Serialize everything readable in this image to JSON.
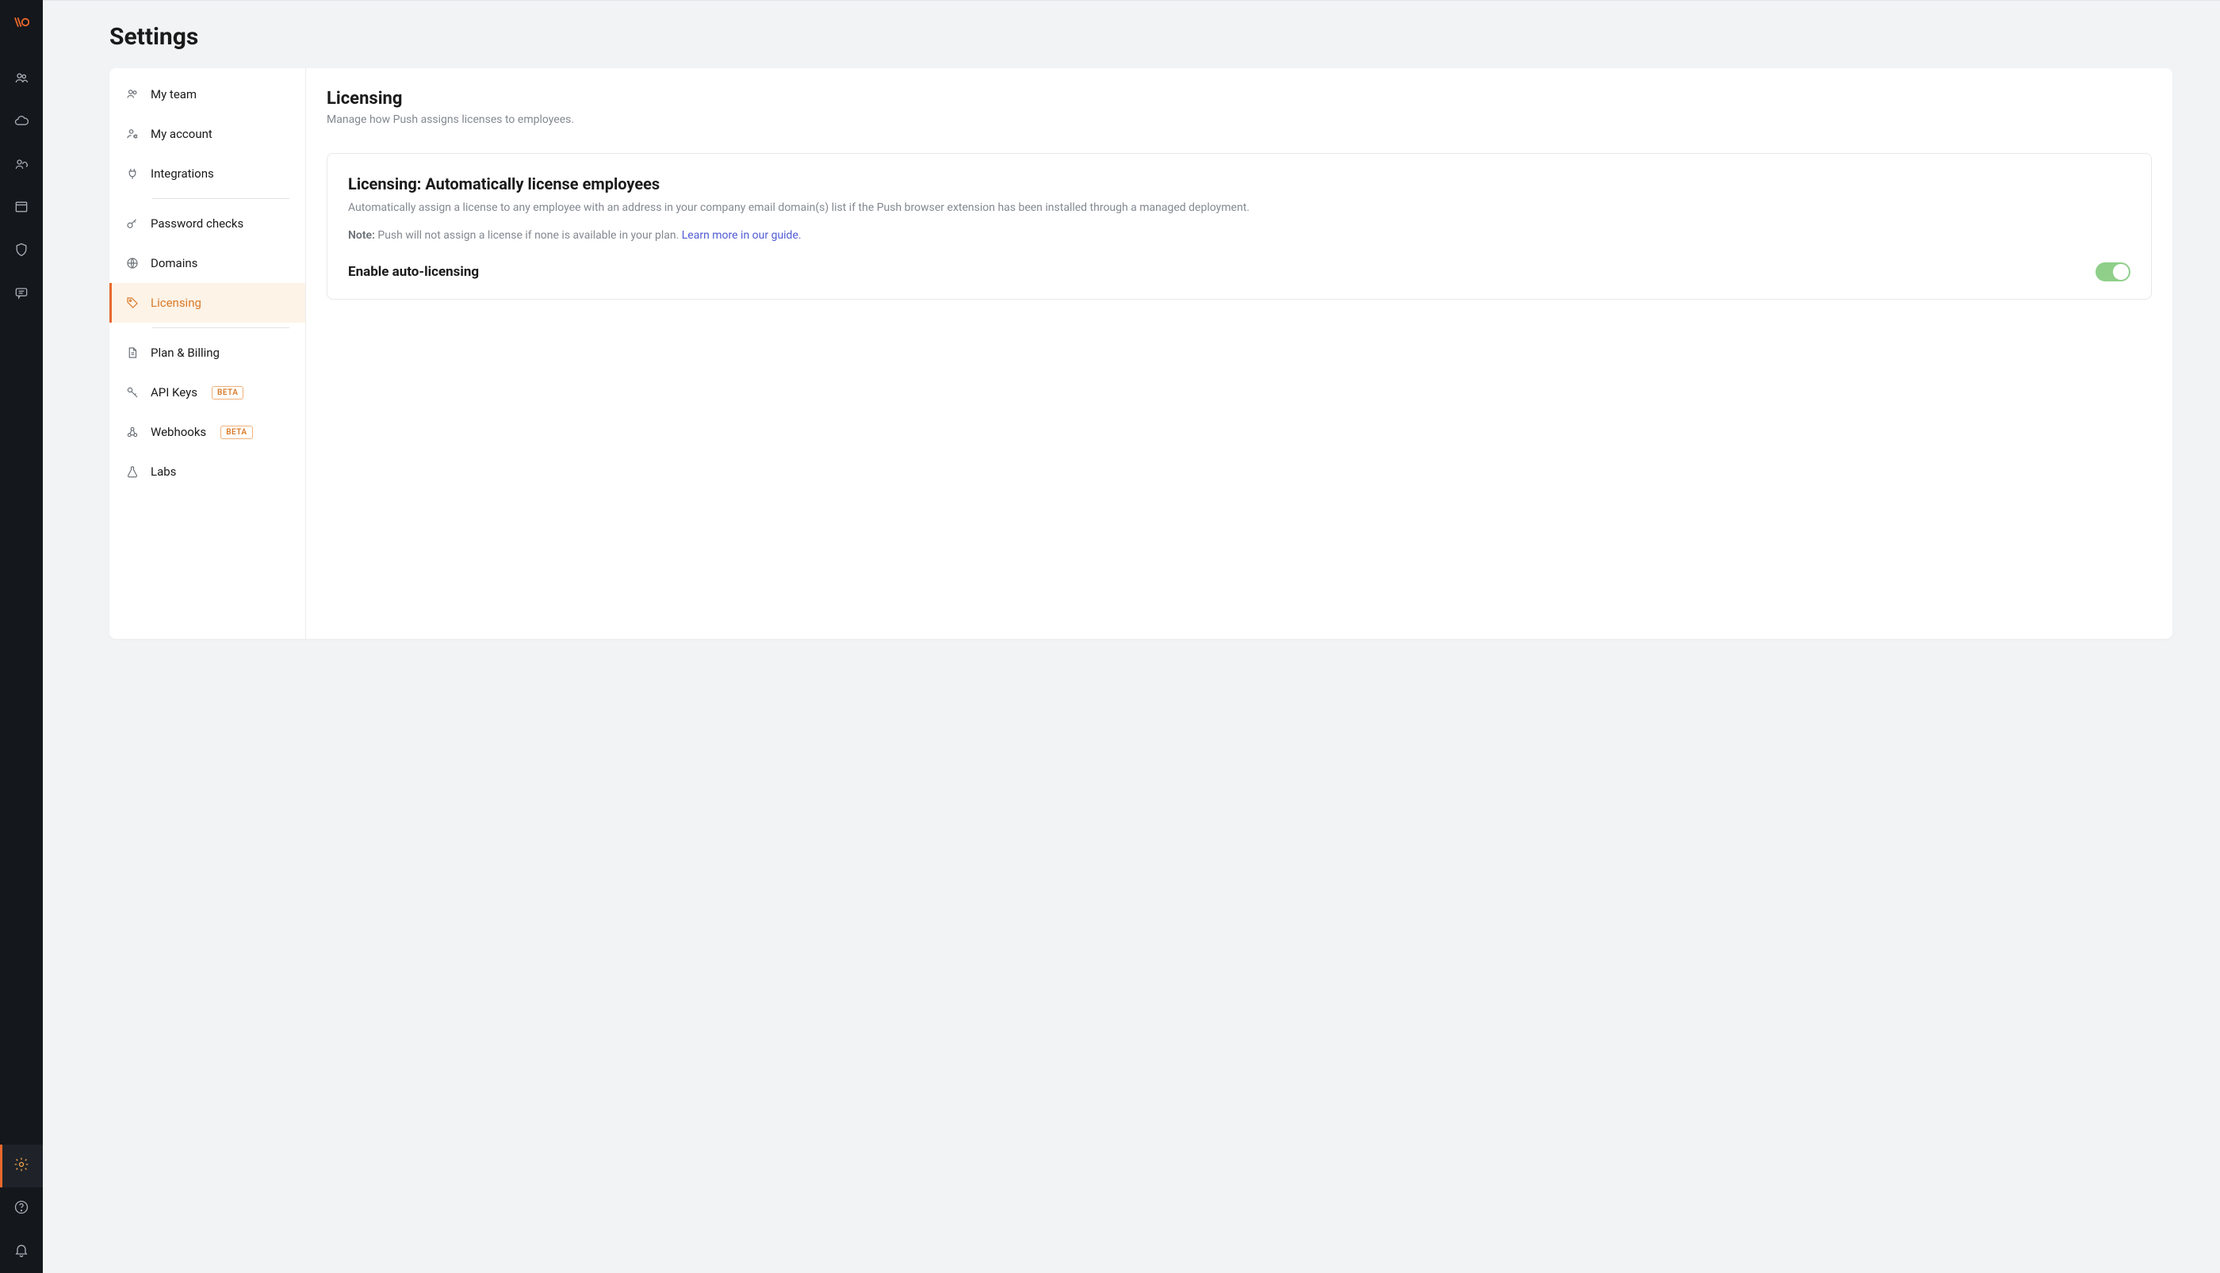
{
  "page": {
    "title": "Settings"
  },
  "rail": {
    "items": [
      {
        "name": "team-icon"
      },
      {
        "name": "cloud-icon"
      },
      {
        "name": "user-cloud-icon"
      },
      {
        "name": "browser-icon"
      },
      {
        "name": "shield-icon"
      },
      {
        "name": "chat-icon"
      }
    ],
    "bottom": [
      {
        "name": "settings-gear-icon",
        "active": true
      },
      {
        "name": "help-icon"
      },
      {
        "name": "bell-icon"
      }
    ]
  },
  "settings_nav": {
    "items": [
      {
        "label": "My team",
        "icon": "team"
      },
      {
        "label": "My account",
        "icon": "user-gear"
      },
      {
        "label": "Integrations",
        "icon": "plug"
      },
      {
        "label": "Password checks",
        "icon": "key"
      },
      {
        "label": "Domains",
        "icon": "globe"
      },
      {
        "label": "Licensing",
        "icon": "tag",
        "active": true
      },
      {
        "label": "Plan & Billing",
        "icon": "doc"
      },
      {
        "label": "API Keys",
        "icon": "key2",
        "badge": "BETA"
      },
      {
        "label": "Webhooks",
        "icon": "webhook",
        "badge": "BETA"
      },
      {
        "label": "Labs",
        "icon": "flask"
      }
    ]
  },
  "panel": {
    "title": "Licensing",
    "subtitle": "Manage how Push assigns licenses to employees."
  },
  "card": {
    "title": "Licensing: Automatically license employees",
    "description": "Automatically assign a license to any employee with an address in your company email domain(s) list if the Push browser extension has been installed through a managed deployment.",
    "note_prefix": "Note:",
    "note_text": " Push will not assign a license if none is available in your plan. ",
    "note_link": "Learn more in our guide.",
    "toggle_label": "Enable auto-licensing",
    "toggle_on": true
  }
}
